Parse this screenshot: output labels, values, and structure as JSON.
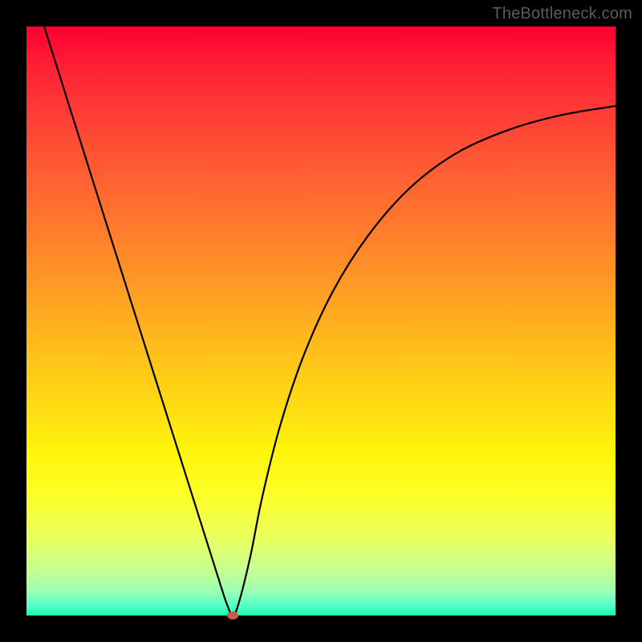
{
  "watermark": "TheBottleneck.com",
  "chart_data": {
    "type": "line",
    "title": "",
    "xlabel": "",
    "ylabel": "",
    "xlim": [
      0,
      100
    ],
    "ylim": [
      0,
      100
    ],
    "grid": false,
    "legend": false,
    "series": [
      {
        "name": "bottleneck-curve",
        "x": [
          3,
          6,
          9,
          12,
          15,
          18,
          21,
          24,
          27,
          30,
          33,
          34,
          35,
          36,
          38,
          40,
          43,
          47,
          52,
          58,
          65,
          73,
          82,
          91,
          100
        ],
        "y": [
          100,
          90.5,
          81,
          71.5,
          62,
          52.5,
          43,
          33.5,
          24,
          14.5,
          5,
          2,
          0,
          2,
          10,
          20,
          32,
          44,
          55,
          64.5,
          72.5,
          78.5,
          82.5,
          85,
          86.5
        ]
      }
    ],
    "marker": {
      "x": 35,
      "y": 0,
      "color": "#cf5a4b"
    },
    "background_gradient": {
      "orientation": "vertical",
      "stops": [
        {
          "pos": 0.0,
          "color": "#ff0030"
        },
        {
          "pos": 0.34,
          "color": "#ff7a2d"
        },
        {
          "pos": 0.66,
          "color": "#ffe012"
        },
        {
          "pos": 0.87,
          "color": "#e8ff5f"
        },
        {
          "pos": 1.0,
          "color": "#18ff9e"
        }
      ]
    }
  }
}
